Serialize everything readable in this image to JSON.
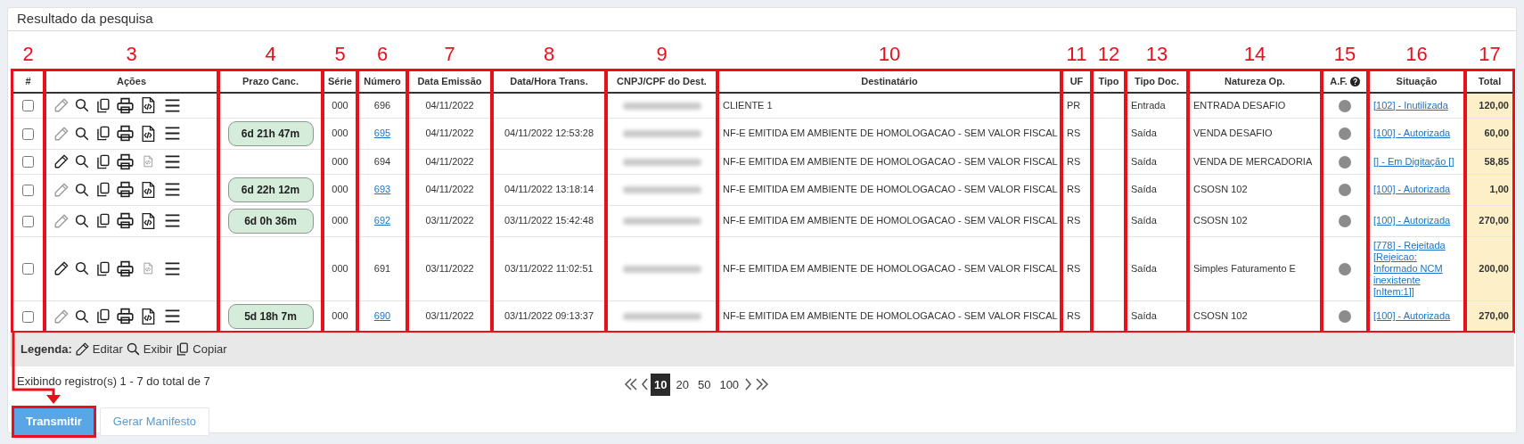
{
  "panel": {
    "title": "Resultado da pesquisa"
  },
  "table": {
    "columns": [
      {
        "label": "#",
        "annotation": "2"
      },
      {
        "label": "Ações",
        "annotation": "3"
      },
      {
        "label": "Prazo Canc.",
        "annotation": "4"
      },
      {
        "label": "Série",
        "annotation": "5"
      },
      {
        "label": "Número",
        "annotation": "6"
      },
      {
        "label": "Data Emissão",
        "annotation": "7"
      },
      {
        "label": "Data/Hora Trans.",
        "annotation": "8"
      },
      {
        "label": "CNPJ/CPF do Dest.",
        "annotation": "9"
      },
      {
        "label": "Destinatário",
        "annotation": "10"
      },
      {
        "label": "UF",
        "annotation": "11"
      },
      {
        "label": "Tipo",
        "annotation": "12"
      },
      {
        "label": "Tipo Doc.",
        "annotation": "13"
      },
      {
        "label": "Natureza Op.",
        "annotation": "14"
      },
      {
        "label": "A.F.",
        "annotation": "15",
        "help": true
      },
      {
        "label": "Situação",
        "annotation": "16"
      },
      {
        "label": "Total",
        "annotation": "17"
      }
    ],
    "rows": [
      {
        "checked": false,
        "edit_enabled": false,
        "xml_enabled": true,
        "serie": "000",
        "numero": "696",
        "numero_link": false,
        "data_emissao": "04/11/2022",
        "destinatario": "CLIENTE 1",
        "uf": "PR",
        "tipo_doc": "Entrada",
        "natureza": "ENTRADA DESAFIO",
        "situacao": "[102] - Inutilizada",
        "total": "120,00"
      },
      {
        "checked": false,
        "edit_enabled": false,
        "xml_enabled": true,
        "prazo": "6d 21h 47m",
        "serie": "000",
        "numero": "695",
        "numero_link": true,
        "data_emissao": "04/11/2022",
        "data_hora": "04/11/2022 12:53:28",
        "destinatario": "NF-E EMITIDA EM AMBIENTE DE HOMOLOGACAO - SEM VALOR FISCAL",
        "uf": "RS",
        "tipo_doc": "Saída",
        "natureza": "VENDA DESAFIO",
        "situacao": "[100] - Autorizada",
        "total": "60,00"
      },
      {
        "checked": false,
        "edit_enabled": true,
        "xml_enabled": false,
        "serie": "000",
        "numero": "694",
        "numero_link": false,
        "data_emissao": "04/11/2022",
        "destinatario": "NF-E EMITIDA EM AMBIENTE DE HOMOLOGACAO - SEM VALOR FISCAL",
        "uf": "RS",
        "tipo_doc": "Saída",
        "natureza": "VENDA DE MERCADORIA",
        "situacao": "[] - Em Digitação []",
        "total": "58,85"
      },
      {
        "checked": false,
        "edit_enabled": false,
        "xml_enabled": true,
        "prazo": "6d 22h 12m",
        "serie": "000",
        "numero": "693",
        "numero_link": true,
        "data_emissao": "04/11/2022",
        "data_hora": "04/11/2022 13:18:14",
        "destinatario": "NF-E EMITIDA EM AMBIENTE DE HOMOLOGACAO - SEM VALOR FISCAL",
        "uf": "RS",
        "tipo_doc": "Saída",
        "natureza": "CSOSN 102",
        "situacao": "[100] - Autorizada",
        "total": "1,00"
      },
      {
        "checked": false,
        "edit_enabled": false,
        "xml_enabled": true,
        "prazo": "6d 0h 36m",
        "serie": "000",
        "numero": "692",
        "numero_link": true,
        "data_emissao": "03/11/2022",
        "data_hora": "03/11/2022 15:42:48",
        "destinatario": "NF-E EMITIDA EM AMBIENTE DE HOMOLOGACAO - SEM VALOR FISCAL",
        "uf": "RS",
        "tipo_doc": "Saída",
        "natureza": "CSOSN 102",
        "situacao": "[100] - Autorizada",
        "total": "270,00"
      },
      {
        "checked": false,
        "edit_enabled": true,
        "xml_enabled": false,
        "serie": "000",
        "numero": "691",
        "numero_link": false,
        "data_emissao": "03/11/2022",
        "data_hora": "03/11/2022 11:02:51",
        "destinatario": "NF-E EMITIDA EM AMBIENTE DE HOMOLOGACAO - SEM VALOR FISCAL",
        "uf": "RS",
        "tipo_doc": "Saída",
        "natureza": "Simples Faturamento E",
        "situacao": "[778] - Rejeitada [Rejeicao: Informado NCM inexistente [nItem:1]]",
        "total": "200,00"
      },
      {
        "checked": false,
        "edit_enabled": false,
        "xml_enabled": true,
        "prazo": "5d 18h 7m",
        "serie": "000",
        "numero": "690",
        "numero_link": true,
        "data_emissao": "03/11/2022",
        "data_hora": "03/11/2022 09:13:37",
        "destinatario": "NF-E EMITIDA EM AMBIENTE DE HOMOLOGACAO - SEM VALOR FISCAL",
        "uf": "RS",
        "tipo_doc": "Saída",
        "natureza": "CSOSN 102",
        "situacao": "[100] - Autorizada",
        "total": "270,00"
      }
    ]
  },
  "legend": {
    "title": "Legenda:",
    "items": [
      {
        "kind": "edit",
        "label": "Editar"
      },
      {
        "kind": "view",
        "label": "Exibir"
      },
      {
        "kind": "copy",
        "label": "Copiar"
      }
    ]
  },
  "status": "Exibindo registro(s) 1 - 7 do total de 7",
  "page_sizes": [
    {
      "label": "10",
      "selected": true
    },
    {
      "label": "20",
      "selected": false
    },
    {
      "label": "50",
      "selected": false
    },
    {
      "label": "100",
      "selected": false
    }
  ],
  "buttons": [
    {
      "label": "Transmitir",
      "kind": "primary",
      "highlighted": true
    },
    {
      "label": "Gerar Manifesto",
      "kind": "secondary",
      "highlighted": false
    }
  ]
}
